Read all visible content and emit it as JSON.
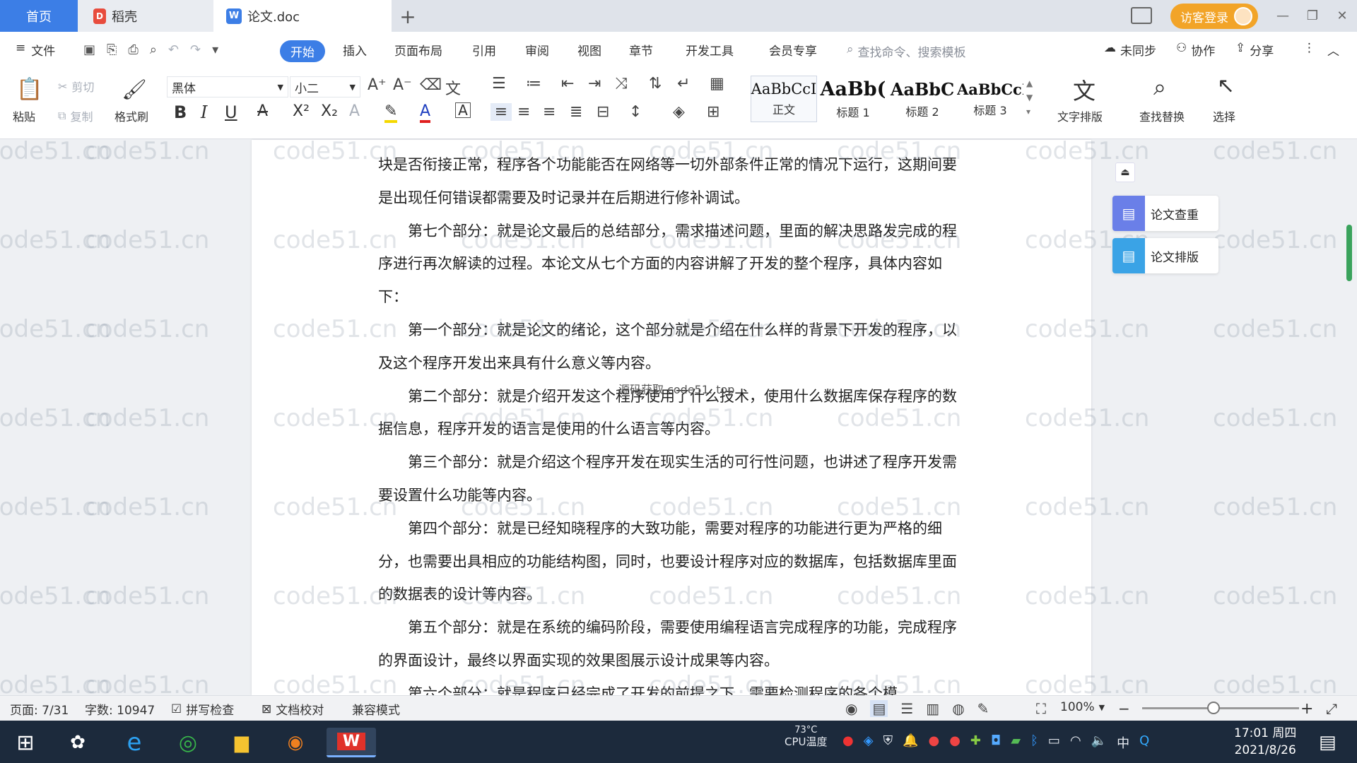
{
  "tabs": {
    "home": "首页",
    "daoke": "稻壳",
    "doc": "论文.doc",
    "new_tab": "+"
  },
  "titlebar": {
    "login": "访客登录"
  },
  "menu": {
    "file": "文件",
    "items": [
      "开始",
      "插入",
      "页面布局",
      "引用",
      "审阅",
      "视图",
      "章节",
      "开发工具",
      "会员专享"
    ],
    "search_placeholder": "查找命令、搜索模板",
    "sync": "未同步",
    "collab": "协作",
    "share": "分享"
  },
  "ribbon": {
    "paste": "粘贴",
    "cut": "剪切",
    "copy": "复制",
    "format_painter": "格式刷",
    "font_name": "黑体",
    "font_size": "小二",
    "styles": [
      {
        "preview": "AaBbCcI",
        "label": "正文"
      },
      {
        "preview": "AaBb(",
        "label": "标题 1"
      },
      {
        "preview": "AaBbC",
        "label": "标题 2"
      },
      {
        "preview": "AaBbCcI",
        "label": "标题 3"
      }
    ],
    "text_layout": "文字排版",
    "find_replace": "查找替换",
    "select": "选择"
  },
  "side_panel": {
    "check": "论文查重",
    "layout": "论文排版"
  },
  "document": {
    "watermark": "code51.cn",
    "overlay_text": "源码获取 code51. top",
    "paragraphs": [
      {
        "indent": false,
        "text": "块是否衔接正常，程序各个功能能否在网络等一切外部条件正常的情况下运行，这期间要是出现任何错误都需要及时记录并在后期进行修补调试。"
      },
      {
        "indent": true,
        "text": "第七个部分：就是论文最后的总结部分，需求描述问题，里面的解决思路发完成的程序进行再次解读的过程。本论文从七个方面的内容讲解了开发的整个程序，具体内容如下："
      },
      {
        "indent": true,
        "text": "第一个部分：就是论文的绪论，这个部分就是介绍在什么样的背景下开发的程序，以及这个程序开发出来具有什么意义等内容。"
      },
      {
        "indent": true,
        "text": "第二个部分：就是介绍开发这个程序使用了什么技术，使用什么数据库保存程序的数据信息，程序开发的语言是使用的什么语言等内容。"
      },
      {
        "indent": true,
        "text": "第三个部分：就是介绍这个程序开发在现实生活的可行性问题，也讲述了程序开发需要设置什么功能等内容。"
      },
      {
        "indent": true,
        "text": "第四个部分：就是已经知晓程序的大致功能，需要对程序的功能进行更为严格的细分，也需要出具相应的功能结构图，同时，也要设计程序对应的数据库，包括数据库里面的数据表的设计等内容。"
      },
      {
        "indent": true,
        "text": "第五个部分：就是在系统的编码阶段，需要使用编程语言完成程序的功能，完成程序的界面设计，最终以界面实现的效果图展示设计成果等内容。"
      },
      {
        "indent": true,
        "text": "第六个部分：就是程序已经完成了开发的前提之下，需要检测程序的各个模"
      }
    ]
  },
  "statusbar": {
    "page": "页面: 7/31",
    "words": "字数: 10947",
    "spell": "拼写检查",
    "proof": "文档校对",
    "compat": "兼容模式",
    "zoom": "100%"
  },
  "taskbar": {
    "temp": "73°C",
    "temp_label": "CPU温度",
    "ime": "中",
    "time": "17:01 周四",
    "date": "2021/8/26"
  }
}
